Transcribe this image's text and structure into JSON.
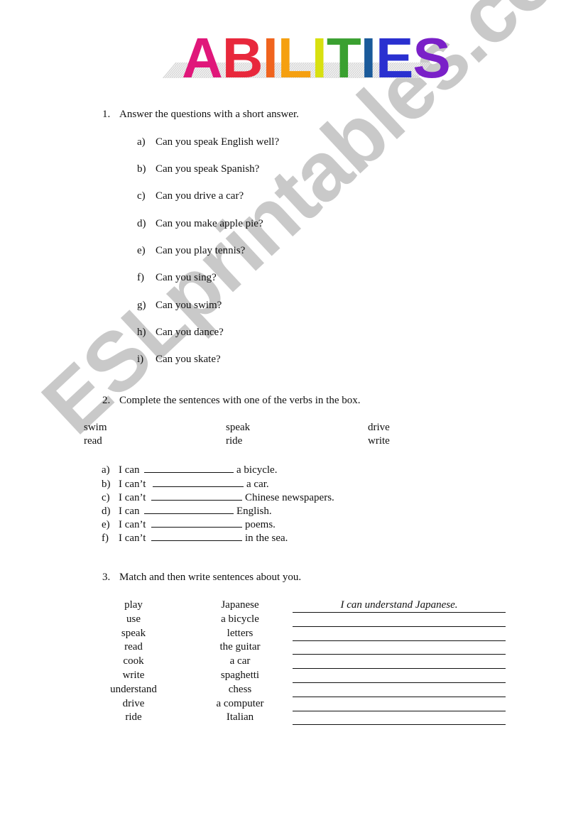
{
  "title": {
    "text": "ABILITIES",
    "letters": [
      {
        "char": "A",
        "color": "#e0177a"
      },
      {
        "char": "B",
        "color": "#e8283c"
      },
      {
        "char": "I",
        "color": "#f0641e"
      },
      {
        "char": "L",
        "color": "#f5a010"
      },
      {
        "char": "I",
        "color": "#d8e010"
      },
      {
        "char": "T",
        "color": "#3aa030"
      },
      {
        "char": "I",
        "color": "#1a5a9a"
      },
      {
        "char": "E",
        "color": "#2a30d0"
      },
      {
        "char": "S",
        "color": "#7a20c8"
      }
    ]
  },
  "watermark": "ESLprintables.com",
  "section1": {
    "number": "1.",
    "instruction": "Answer the questions with a short answer.",
    "questions": [
      {
        "label": "a)",
        "text": "Can you speak English well?"
      },
      {
        "label": "b)",
        "text": "Can you speak Spanish?"
      },
      {
        "label": "c)",
        "text": "Can you drive a car?"
      },
      {
        "label": "d)",
        "text": "Can you make apple pie?"
      },
      {
        "label": "e)",
        "text": "Can you play tennis?"
      },
      {
        "label": "f)",
        "text": "Can you sing?"
      },
      {
        "label": "g)",
        "text": "Can you swim?"
      },
      {
        "label": "h)",
        "text": "Can you dance?"
      },
      {
        "label": "i)",
        "text": "Can you skate?"
      }
    ]
  },
  "section2": {
    "number": "2.",
    "instruction": "Complete the sentences with one of the verbs in the box.",
    "verb_box": [
      [
        "swim",
        "speak",
        "drive"
      ],
      [
        "read",
        "ride",
        "write"
      ]
    ],
    "sentences": [
      {
        "label": "a)",
        "start": "I can",
        "end": "a bicycle."
      },
      {
        "label": "b)",
        "start": "I can’t",
        "end": "a car."
      },
      {
        "label": "c)",
        "start": "I can’t",
        "end": "Chinese newspapers."
      },
      {
        "label": "d)",
        "start": "I can",
        "end": "English."
      },
      {
        "label": "e)",
        "start": "I can’t",
        "end": "poems."
      },
      {
        "label": "f)",
        "start": "I can’t",
        "end": "in the sea."
      }
    ]
  },
  "section3": {
    "number": "3.",
    "instruction": "Match and then write sentences about you.",
    "verbs": [
      "play",
      "use",
      "speak",
      "read",
      "cook",
      "write",
      "understand",
      "drive",
      "ride"
    ],
    "objects": [
      "Japanese",
      "a bicycle",
      "letters",
      "the guitar",
      "a car",
      "spaghetti",
      "chess",
      "a computer",
      "Italian"
    ],
    "example_answer": "I can understand Japanese."
  }
}
